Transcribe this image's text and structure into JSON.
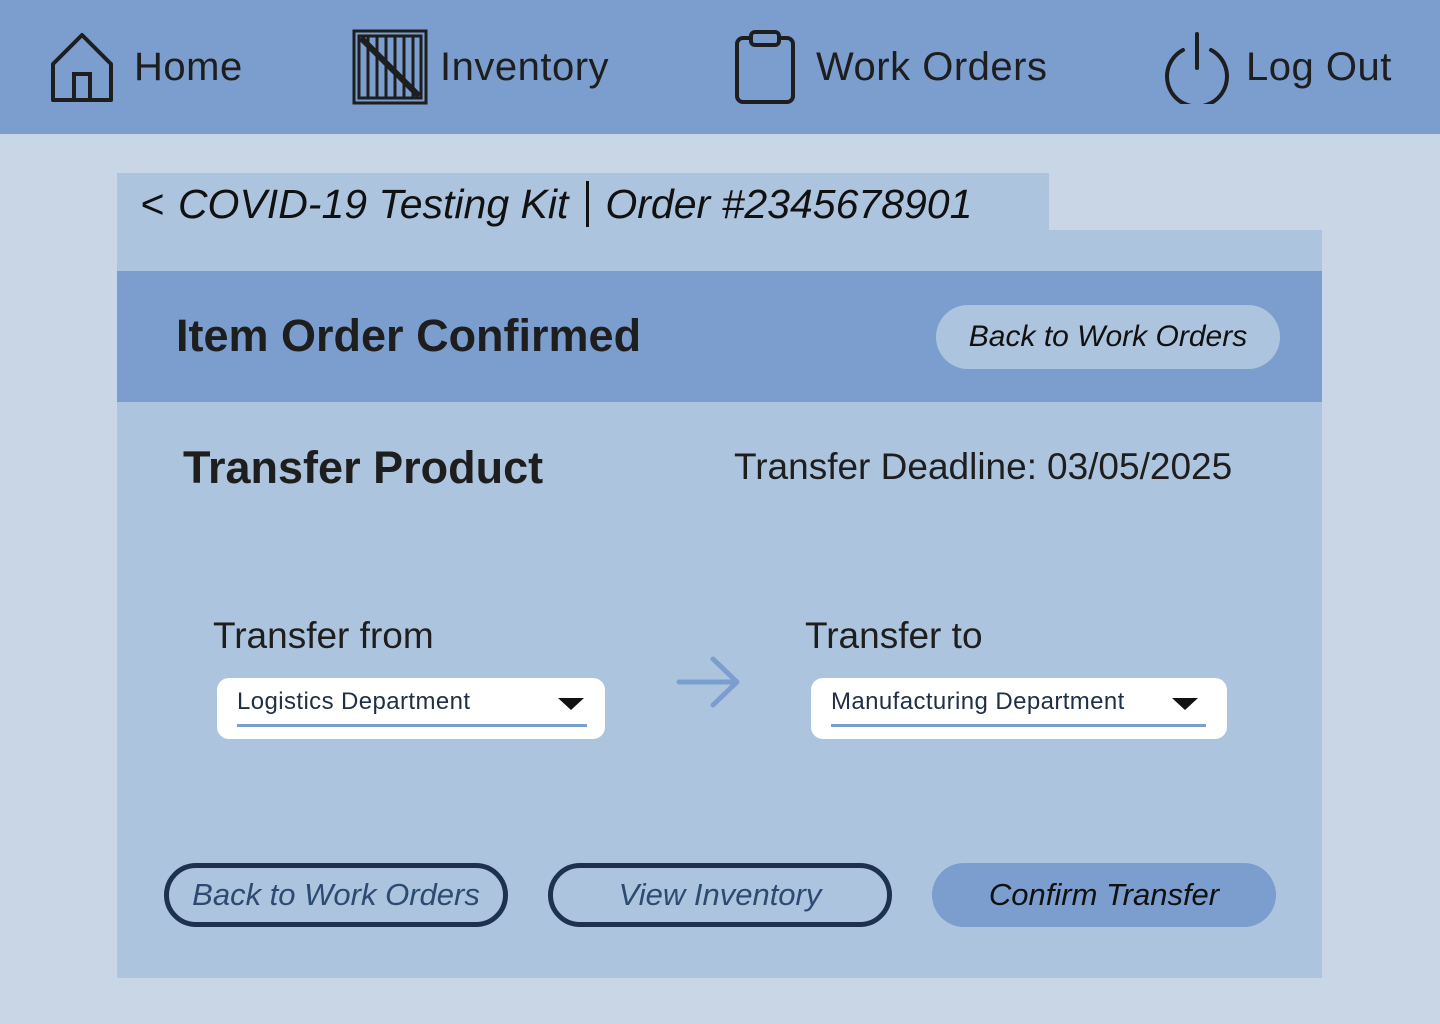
{
  "nav": {
    "home": {
      "label": "Home",
      "icon": "home-icon"
    },
    "inventory": {
      "label": "Inventory",
      "icon": "crate-icon"
    },
    "work_orders": {
      "label": "Work Orders",
      "icon": "clipboard-icon"
    },
    "logout": {
      "label": "Log Out",
      "icon": "power-icon"
    }
  },
  "breadcrumb": {
    "back_symbol": "<",
    "product": "COVID-19 Testing Kit",
    "order": "Order #2345678901"
  },
  "banner": {
    "title": "Item Order Confirmed",
    "back_button": "Back to Work Orders"
  },
  "transfer": {
    "title": "Transfer Product",
    "deadline_label": "Transfer Deadline:",
    "deadline_value": "03/05/2025",
    "from_label": "Transfer from",
    "from_value": "Logistics Department",
    "to_label": "Transfer to",
    "to_value": "Manufacturing Department",
    "arrow_icon": "arrow-right-icon"
  },
  "actions": {
    "back": "Back to Work Orders",
    "view_inventory": "View Inventory",
    "confirm": "Confirm Transfer"
  },
  "colors": {
    "nav_bg": "#7b9ecf",
    "page_bg": "#c8d6e5",
    "panel_bg": "#adc4de",
    "button_outline": "#1e3250",
    "accent": "#7b9ecf"
  }
}
